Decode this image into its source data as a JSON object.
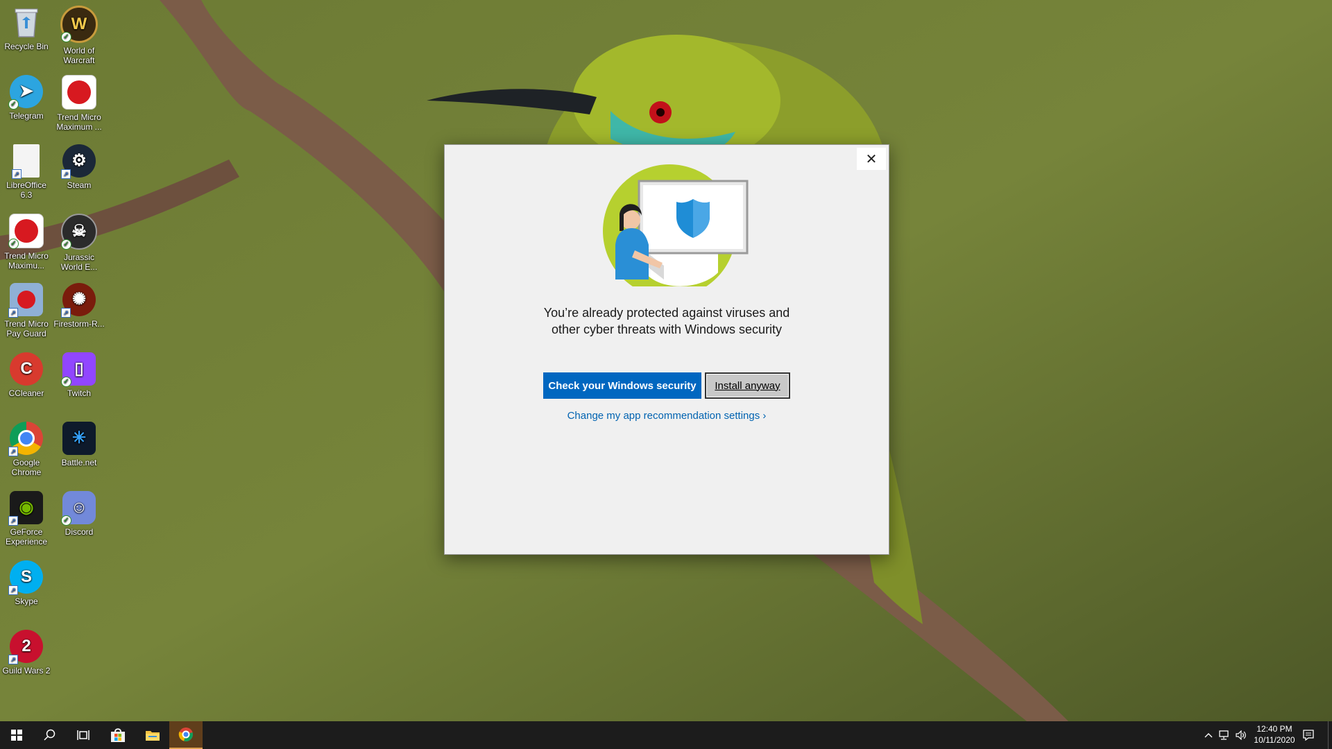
{
  "desktop_icons": [
    {
      "label": "Recycle Bin",
      "icon": "recycle-bin-icon",
      "color": "#9fb3c8"
    },
    {
      "label": "World of Warcraft",
      "icon": "world-of-warcraft-icon",
      "color": "#3a2a10"
    },
    {
      "label": "Telegram",
      "icon": "telegram-icon",
      "color": "#2ca5e0"
    },
    {
      "label": "Trend Micro Maximum ...",
      "icon": "trend-micro-icon",
      "color": "#d71920"
    },
    {
      "label": "LibreOffice 6.3",
      "icon": "libreoffice-icon",
      "color": "#f4f4f4"
    },
    {
      "label": "Steam",
      "icon": "steam-icon",
      "color": "#1b2838"
    },
    {
      "label": "Trend Micro Maximu...",
      "icon": "trend-micro-icon",
      "color": "#d71920"
    },
    {
      "label": "Jurassic World E...",
      "icon": "jurassic-world-icon",
      "color": "#2b2b2b"
    },
    {
      "label": "Trend Micro Pay Guard",
      "icon": "trend-micro-pay-guard-icon",
      "color": "#8fb0d6"
    },
    {
      "label": "Firestorm-R...",
      "icon": "firestorm-icon",
      "color": "#7a1c0c"
    },
    {
      "label": "CCleaner",
      "icon": "ccleaner-icon",
      "color": "#d83a2e"
    },
    {
      "label": "Twitch",
      "icon": "twitch-icon",
      "color": "#9146ff"
    },
    {
      "label": "Google Chrome",
      "icon": "chrome-icon",
      "color": "#4285f4"
    },
    {
      "label": "Battle.net",
      "icon": "battle-net-icon",
      "color": "#0e1a2b"
    },
    {
      "label": "GeForce Experience",
      "icon": "geforce-icon",
      "color": "#1a1a1a"
    },
    {
      "label": "Discord",
      "icon": "discord-icon",
      "color": "#7289da"
    },
    {
      "label": "Skype",
      "icon": "skype-icon",
      "color": "#00aff0"
    },
    {
      "label": "Guild Wars 2",
      "icon": "guild-wars-icon",
      "color": "#c8102e"
    }
  ],
  "dialog": {
    "message": "You’re already protected against viruses and other cyber threats with Windows security",
    "primary_button": "Check your Windows security",
    "secondary_button": "Install anyway",
    "settings_link": "Change my app recommendation settings ›",
    "close_glyph": "✕"
  },
  "taskbar": {
    "time": "12:40 PM",
    "date": "10/11/2020"
  },
  "colors": {
    "accent": "#0067c0",
    "link": "#0063b1",
    "taskbar": "#1c1c1c"
  }
}
